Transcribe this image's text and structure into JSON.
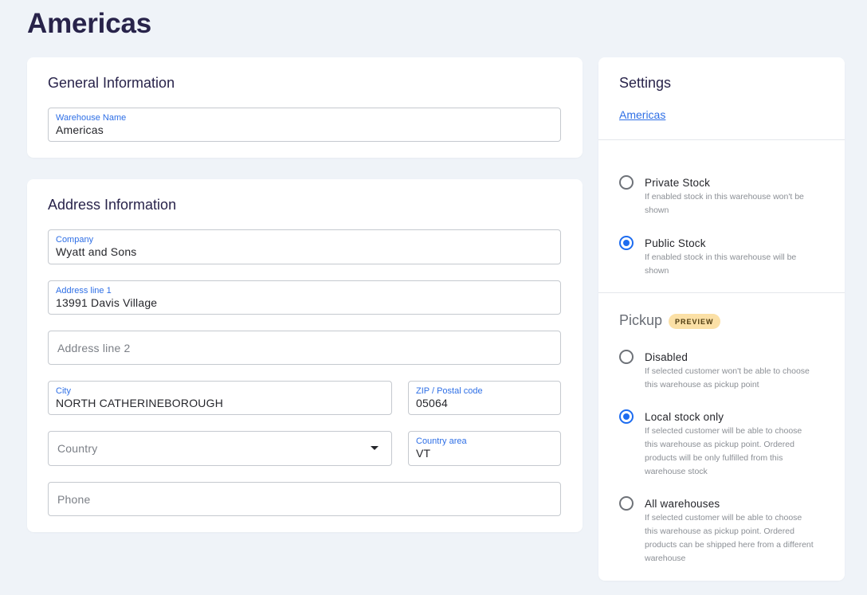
{
  "page": {
    "title": "Americas"
  },
  "general": {
    "title": "General Information",
    "warehouse_name": {
      "label": "Warehouse Name",
      "value": "Americas"
    }
  },
  "address": {
    "title": "Address Information",
    "company": {
      "label": "Company",
      "value": "Wyatt and Sons"
    },
    "address1": {
      "label": "Address line 1",
      "value": "13991 Davis Village"
    },
    "address2": {
      "placeholder": "Address line 2"
    },
    "city": {
      "label": "City",
      "value": "NORTH CATHERINEBOROUGH"
    },
    "zip": {
      "label": "ZIP / Postal code",
      "value": "05064"
    },
    "country": {
      "placeholder": "Country"
    },
    "country_area": {
      "label": "Country area",
      "value": "VT"
    },
    "phone": {
      "placeholder": "Phone"
    }
  },
  "settings": {
    "title": "Settings",
    "link": "Americas",
    "stock_options": [
      {
        "label": "Private Stock",
        "desc": "If enabled stock in this warehouse won't be shown",
        "checked": false
      },
      {
        "label": "Public Stock",
        "desc": "If enabled stock in this warehouse will be shown",
        "checked": true
      }
    ],
    "pickup": {
      "title": "Pickup",
      "badge": "PREVIEW",
      "options": [
        {
          "label": "Disabled",
          "desc": "If selected customer won't be able to choose this warehouse as pickup point",
          "checked": false
        },
        {
          "label": "Local stock only",
          "desc": "If selected customer will be able to choose this warehouse as pickup point. Ordered products will be only fulfilled from this warehouse stock",
          "checked": true
        },
        {
          "label": "All warehouses",
          "desc": "If selected customer will be able to choose this warehouse as pickup point. Ordered products can be shipped here from a different warehouse",
          "checked": false
        }
      ]
    }
  },
  "colors": {
    "accent": "#1d6cf0",
    "background": "#eff3f8",
    "badge": "#fbe0a6"
  }
}
